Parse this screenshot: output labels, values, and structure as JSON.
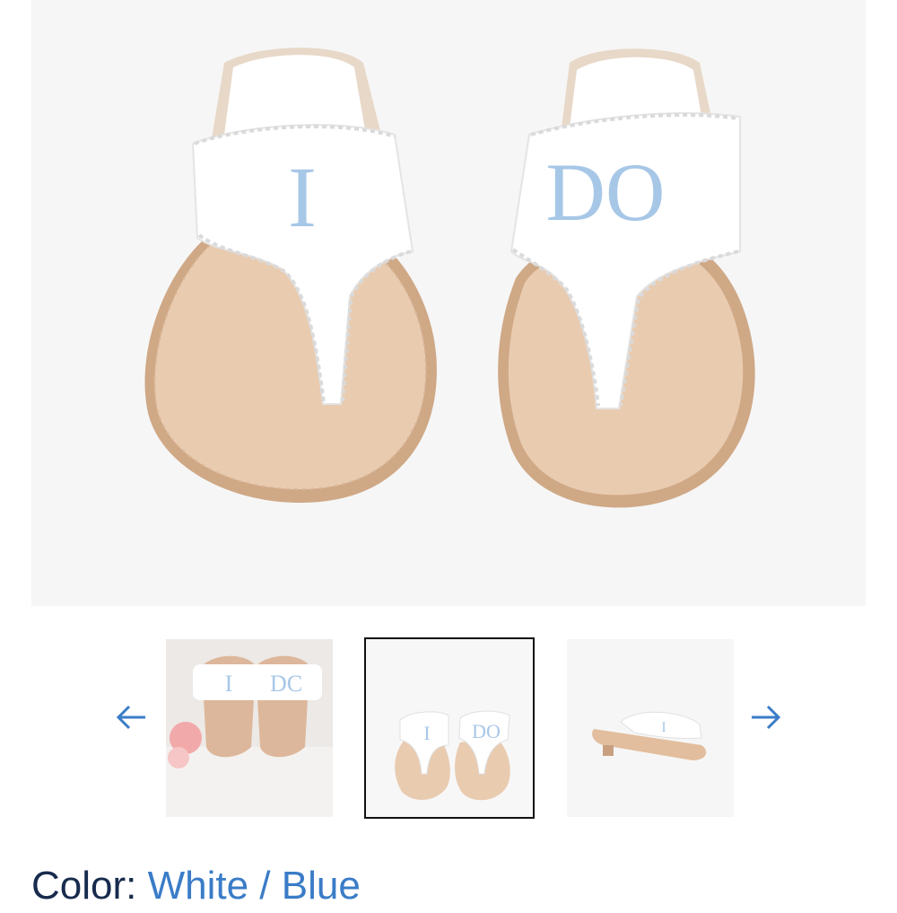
{
  "product": {
    "left_strap_text": "I",
    "right_strap_text": "DO",
    "color_label": "Color:",
    "color_value": "White / Blue"
  },
  "gallery": {
    "prev_icon": "arrow-left-icon",
    "next_icon": "arrow-right-icon",
    "thumbnails": [
      {
        "left_text": "I",
        "right_text": "DC",
        "selected": false
      },
      {
        "left_text": "I",
        "right_text": "DO",
        "selected": true
      },
      {
        "left_text": "I",
        "right_text": "",
        "selected": false
      }
    ]
  },
  "colors": {
    "accent_blue": "#3a7cc7",
    "embroidery_blue": "#a7c7e7",
    "sole": "#e7c7aa",
    "text_dark": "#172b4d"
  }
}
